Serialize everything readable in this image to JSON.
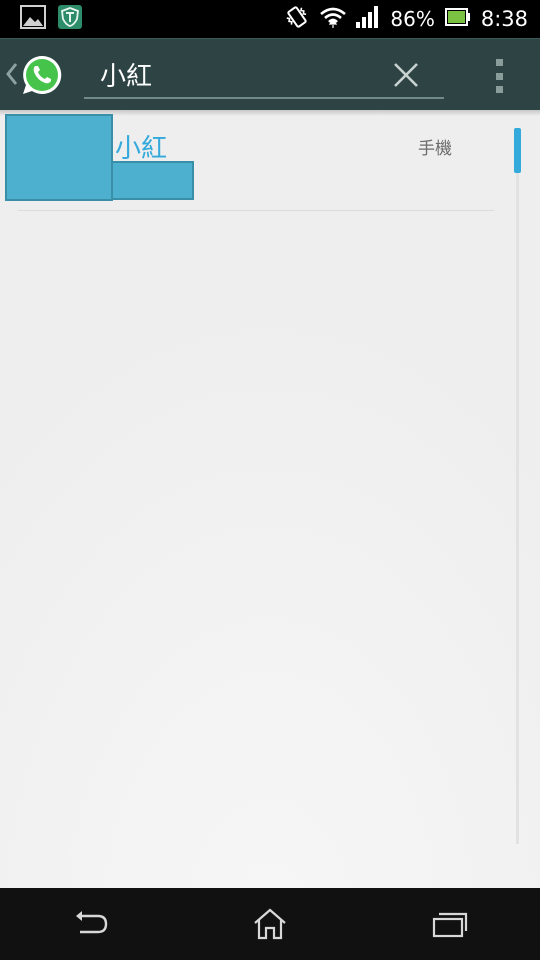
{
  "status_bar": {
    "battery_percent": "86%",
    "time": "8:38",
    "icons": [
      "gallery-notification-icon",
      "vpn-shield-icon",
      "vibrate-icon",
      "wifi-icon",
      "signal-icon",
      "battery-icon"
    ]
  },
  "action_bar": {
    "app_icon": "whatsapp-icon",
    "search_value": "小紅",
    "clear_icon": "close-icon",
    "menu_icon": "overflow-menu-icon"
  },
  "results": [
    {
      "name": "小紅",
      "type": "手機"
    }
  ],
  "scroll_position": 0.0,
  "nav_bar": {
    "icons": [
      "back-icon",
      "home-icon",
      "recent-apps-icon"
    ]
  },
  "colors": {
    "action_bar": "#2e4444",
    "accent": "#33a9dc",
    "redaction": "#4eb0cf",
    "whatsapp_green": "#45c34a"
  }
}
